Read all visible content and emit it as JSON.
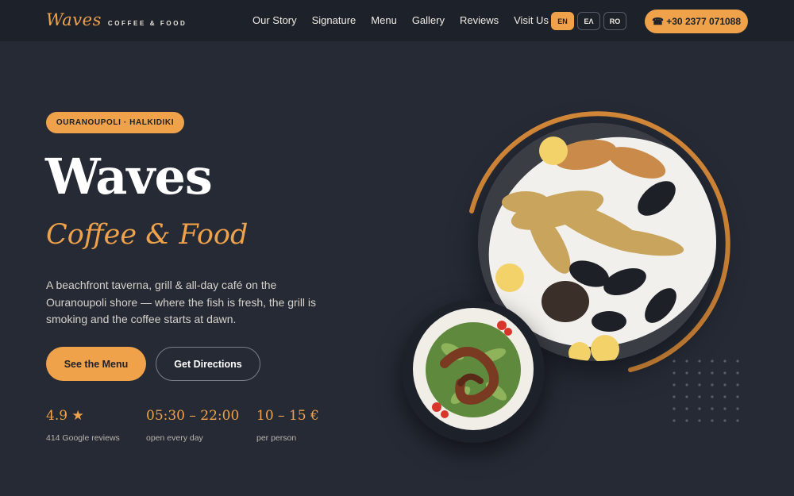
{
  "brand": {
    "script": "Waves",
    "sub": "COFFEE & FOOD"
  },
  "nav": {
    "links": [
      "Our Story",
      "Signature",
      "Menu",
      "Gallery",
      "Reviews",
      "Visit Us"
    ],
    "languages": [
      {
        "code": "EN",
        "active": true
      },
      {
        "code": "ΕΛ",
        "active": false
      },
      {
        "code": "RO",
        "active": false
      }
    ],
    "phone": "☎ +30 2377 071088"
  },
  "hero": {
    "location": "OURANOUPOLI · HALKIDIKI",
    "title": "Waves",
    "subtitle": "Coffee & Food",
    "description": "A beachfront taverna, grill & all-day café on the Ouranoupoli shore — where the fish is fresh, the grill is smoking and the coffee starts at dawn.",
    "primary_button": "See the Menu",
    "secondary_button": "Get Directions",
    "stats": [
      {
        "value": "4.9 ★",
        "label": "414 Google reviews"
      },
      {
        "value": "05:30 – 22:00",
        "label": "open every day"
      },
      {
        "value": "10 – 15 €",
        "label": "per person"
      }
    ]
  },
  "icons": {
    "phone": "phone-icon",
    "star": "star-icon"
  },
  "colors": {
    "accent": "#efa24a",
    "background": "#252a35",
    "nav_bg": "#1d212a"
  }
}
